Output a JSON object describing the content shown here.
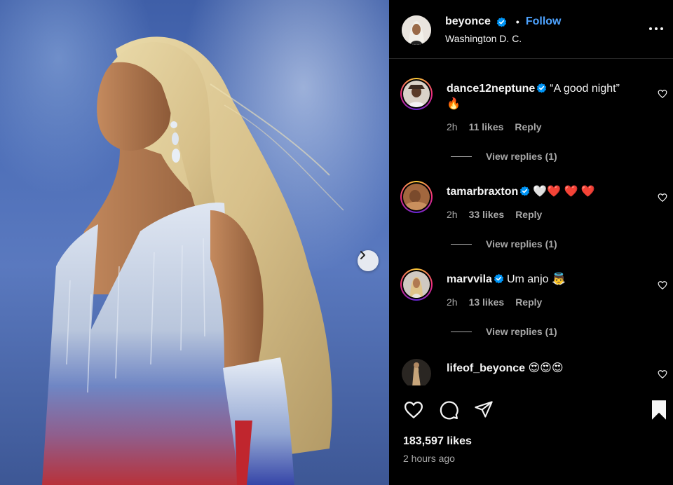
{
  "post": {
    "username": "beyonce",
    "separator": "•",
    "follow_label": "Follow",
    "location": "Washington D. C.",
    "likes": "183,597 likes",
    "time_ago": "2 hours ago"
  },
  "comments": [
    {
      "username": "dance12neptune",
      "verified": true,
      "text": "“A good night”",
      "text_line2": "🔥",
      "time": "2h",
      "likes": "11 likes",
      "reply_label": "Reply",
      "view_replies": "View replies (1)"
    },
    {
      "username": "tamarbraxton",
      "verified": true,
      "text": "🤍❤️ ❤️ ❤️",
      "time": "2h",
      "likes": "33 likes",
      "reply_label": "Reply",
      "view_replies": "View replies (1)"
    },
    {
      "username": "marvvila",
      "verified": true,
      "text": "Um anjo 👼",
      "time": "2h",
      "likes": "13 likes",
      "reply_label": "Reply",
      "view_replies": "View replies (1)"
    },
    {
      "username": "lifeof_beyonce",
      "verified": false,
      "text": "😍😍😍"
    }
  ],
  "icons": {
    "like": "heart-icon",
    "comment": "comment-icon",
    "share": "paper-plane-icon",
    "save": "bookmark-icon",
    "next": "chevron-right-icon",
    "more": "more-horizontal-icon",
    "verified": "verified-badge-icon"
  },
  "colors": {
    "link": "#4ea3ff",
    "verified": "#0095f6",
    "muted": "#a8a8a8",
    "background": "#000000"
  }
}
